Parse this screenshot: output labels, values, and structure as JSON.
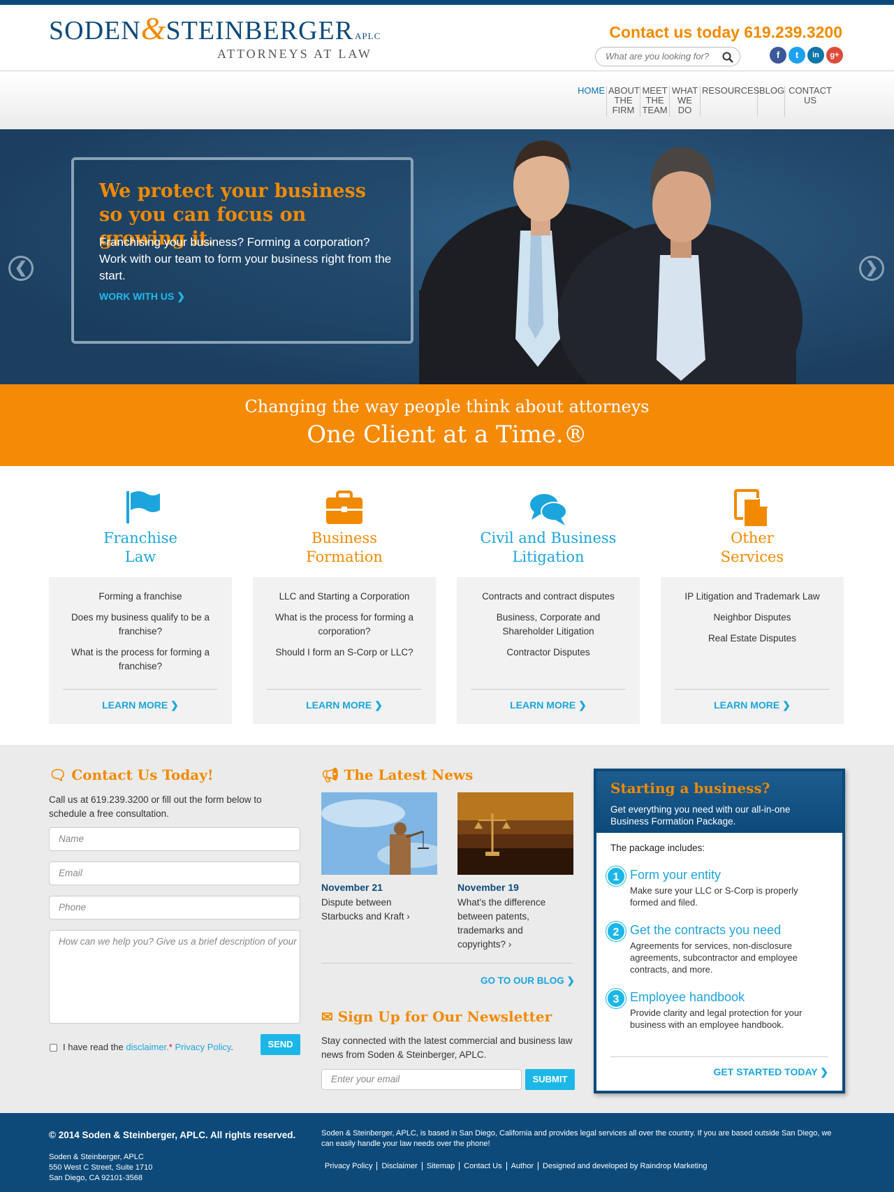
{
  "header": {
    "logo_name_1": "SODEN",
    "logo_amp": "&",
    "logo_name_2": "STEINBERGER",
    "logo_suffix": "APLC",
    "logo_subtitle": "ATTORNEYS AT LAW",
    "contact": "Contact us today 619.239.3200",
    "search_placeholder": "What are you looking for?",
    "social": [
      {
        "icon": "facebook-icon",
        "glyph": "f",
        "color": "#3b5998"
      },
      {
        "icon": "twitter-icon",
        "glyph": "t",
        "color": "#1da1f2"
      },
      {
        "icon": "linkedin-icon",
        "glyph": "in",
        "color": "#0e76a8"
      },
      {
        "icon": "google-plus-icon",
        "glyph": "g+",
        "color": "#dd4b39"
      }
    ]
  },
  "nav": [
    {
      "label": "HOME",
      "active": true
    },
    {
      "label": "ABOUT THE FIRM"
    },
    {
      "label": "MEET THE TEAM"
    },
    {
      "label": "WHAT WE DO"
    },
    {
      "label": "RESOURCES"
    },
    {
      "label": "BLOG"
    },
    {
      "label": "CONTACT US"
    }
  ],
  "hero": {
    "title": "We protect your business so you can focus on growing it.",
    "text": "Franchising your business? Forming a corporation? Work with our team to form your business right from the start.",
    "cta": "WORK WITH US",
    "cta_icon": "chevron-right-circle-icon"
  },
  "tagline": {
    "line1": "Changing the way people think about attorneys",
    "line2": "One Client at a Time.®"
  },
  "services": [
    {
      "title": "Franchise Law",
      "icon": "flag-icon",
      "color": "#1ba5dc",
      "links": [
        "Forming a franchise",
        "Does my business qualify to be a franchise?",
        "What is the process for forming a franchise?"
      ],
      "more": "LEARN MORE"
    },
    {
      "title": "Business Formation",
      "icon": "briefcase-icon",
      "color": "#f18a00",
      "links": [
        "LLC and Starting a Corporation",
        "What is the process for forming a corporation?",
        "Should I form an S-Corp or LLC?"
      ],
      "more": "LEARN MORE"
    },
    {
      "title": "Civil and Business Litigation",
      "icon": "speech-bubbles-icon",
      "color": "#1ba5dc",
      "links": [
        "Contracts and contract disputes",
        "Business, Corporate and Shareholder Litigation",
        "Contractor Disputes"
      ],
      "more": "LEARN MORE"
    },
    {
      "title": "Other Services",
      "icon": "document-icon",
      "color": "#f18a00",
      "links": [
        "IP Litigation and Trademark Law",
        "Neighbor Disputes",
        "Real Estate Disputes"
      ],
      "more": "LEARN MORE"
    }
  ],
  "contact_form": {
    "heading": "Contact Us Today!",
    "intro": "Call us at 619.239.3200 or fill out the form below to schedule a free consultation.",
    "name_placeholder": "Name",
    "email_placeholder": "Email",
    "phone_placeholder": "Phone",
    "message_placeholder": "How can we help you? Give us a brief description of your",
    "disclaimer_pre": "I have read the",
    "disclaimer_link": "disclaimer.",
    "required_mark": "*",
    "privacy_link": "Privacy Policy",
    "period": ".",
    "send": "SEND"
  },
  "news": {
    "heading": "The Latest News",
    "items": [
      {
        "date": "November 21",
        "text": "Dispute between Starbucks and Kraft ›"
      },
      {
        "date": "November 19",
        "text": "What's the difference between patents, trademarks and copyrights? ›"
      }
    ],
    "blog_link": "GO TO OUR BLOG"
  },
  "newsletter": {
    "heading": "Sign Up for Our Newsletter",
    "text": "Stay connected with the latest commercial and business law news from Soden & Steinberger, APLC.",
    "email_placeholder": "Enter your email",
    "submit": "SUBMIT"
  },
  "package": {
    "title": "Starting a business?",
    "subtitle": "Get everything you need with our all-in-one Business Formation Package.",
    "includes": "The package includes:",
    "steps": [
      {
        "num": "1",
        "title": "Form your entity",
        "text": "Make sure your LLC or S-Corp is properly formed and filed."
      },
      {
        "num": "2",
        "title": "Get the contracts you need",
        "text": "Agreements for services, non-disclosure agreements, subcontractor and employee contracts, and more."
      },
      {
        "num": "3",
        "title": "Employee handbook",
        "text": "Provide clarity and legal protection for your business with an employee handbook."
      }
    ],
    "cta": "GET STARTED TODAY"
  },
  "footer": {
    "copyright": "© 2014 Soden & Steinberger, APLC. All rights reserved.",
    "address": [
      "Soden & Steinberger, APLC",
      "550 West C Street, Suite 1710",
      "San Diego, CA 92101-3568"
    ],
    "about": "Soden & Steinberger, APLC, is based in San Diego, California and provides legal services all over the country. If you are based outside San Diego, we can easily handle your law needs over the phone!",
    "links": [
      "Privacy Policy",
      "Disclaimer",
      "Sitemap",
      "Contact Us",
      "Author",
      "Designed and developed by Raindrop Marketing"
    ]
  },
  "colors": {
    "brand_blue": "#0d4a7a",
    "brand_orange": "#f18a00",
    "accent_cyan": "#1ba5dc"
  }
}
